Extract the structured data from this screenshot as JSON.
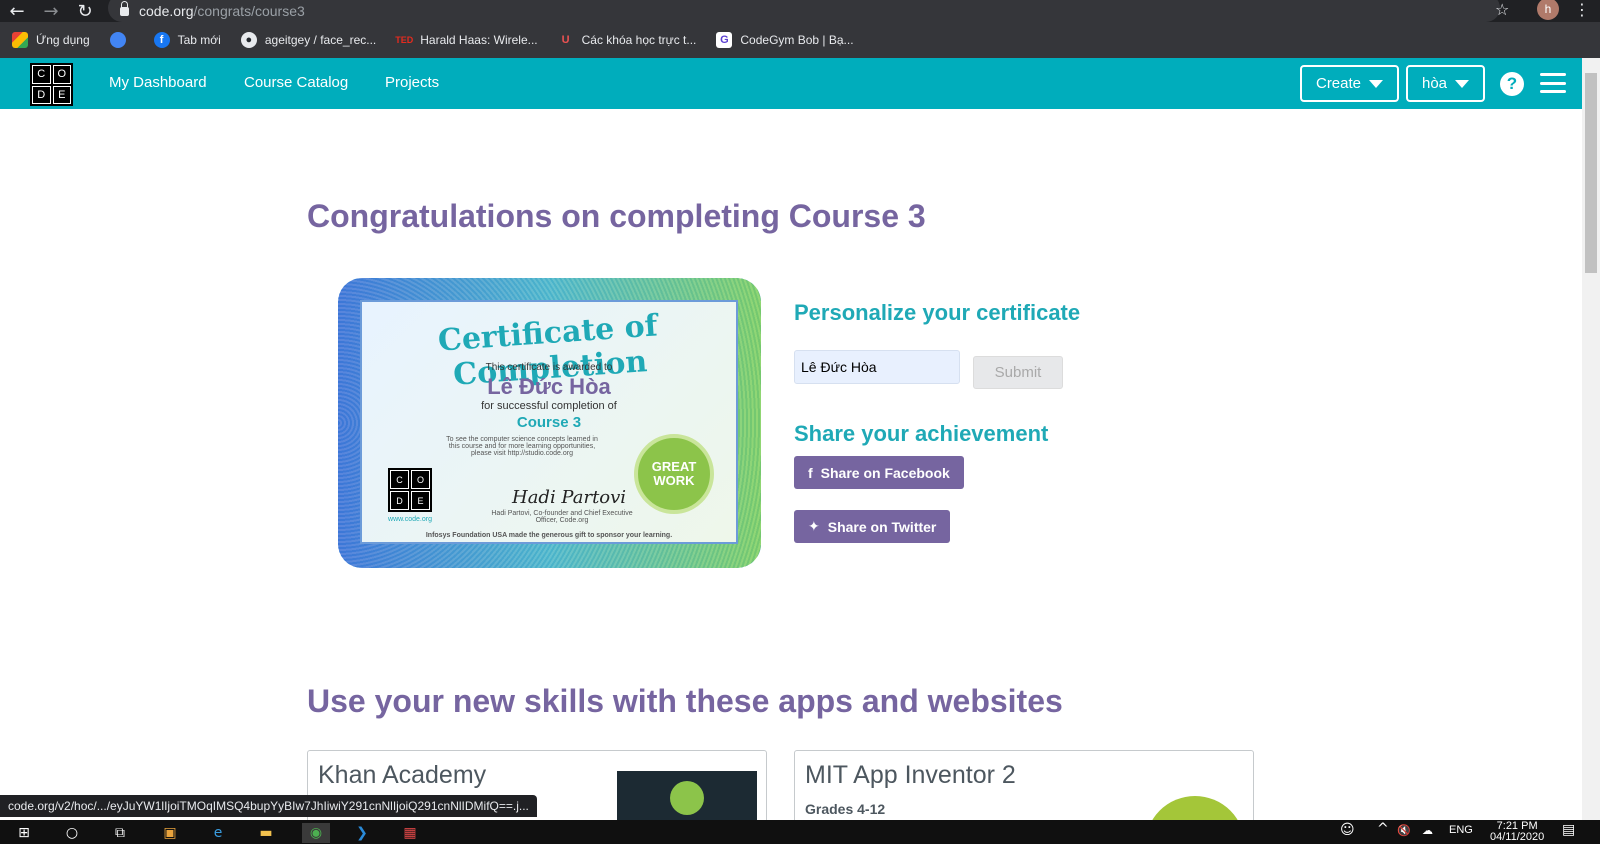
{
  "browser": {
    "url_host": "code.org",
    "url_path": "/congrats/course3",
    "profile_initial": "h",
    "bookmarks": [
      {
        "label": "Ứng dụng",
        "icon": "apps-grid-icon",
        "color": "#e94235"
      },
      {
        "label": "",
        "icon": "chrome-web-store-icon",
        "color": "#4285f4"
      },
      {
        "label": "Tab mới",
        "icon": "facebook-icon",
        "color": "#1877f2"
      },
      {
        "label": "ageitgey / face_rec...",
        "icon": "github-icon",
        "color": "#24292e"
      },
      {
        "label": "Harald Haas: Wirele...",
        "icon": "ted-icon",
        "color": "#e62b1e"
      },
      {
        "label": "Các khóa học trực t...",
        "icon": "udemy-icon",
        "color": "#ec5252"
      },
      {
        "label": "CodeGym Bob | Bạ...",
        "icon": "codegym-icon",
        "color": "#5b3fd1"
      }
    ]
  },
  "header": {
    "logo_letters": [
      "C",
      "O",
      "D",
      "E"
    ],
    "nav": [
      "My Dashboard",
      "Course Catalog",
      "Projects"
    ],
    "create_label": "Create",
    "user_label": "hòa",
    "help_label": "?"
  },
  "main": {
    "title": "Congratulations on completing Course 3",
    "certificate": {
      "heading": "Certificate of Completion",
      "awarded": "This certificate is awarded to",
      "name": "Lê Đức Hòa",
      "completion": "for successful completion of",
      "course": "Course 3",
      "info": "To see the computer science concepts learned in this course and for more learning opportunities, please visit http://studio.code.org",
      "signature": "Hadi Partovi",
      "signer": "Hadi Partovi, Co-founder and Chief Executive Officer, Code.org",
      "website": "www.code.org",
      "sponsor": "Infosys Foundation USA made the generous gift to sponsor your learning.",
      "badge": "GREAT WORK"
    },
    "personalize_heading": "Personalize your certificate",
    "name_value": "Lê Đức Hòa",
    "submit_label": "Submit",
    "share_heading": "Share your achievement",
    "share_facebook": "Share on Facebook",
    "share_twitter": "Share on Twitter",
    "apps_heading": "Use your new skills with these apps and websites",
    "cards": [
      {
        "title": "Khan Academy",
        "subtitle": ""
      },
      {
        "title": "MIT App Inventor 2",
        "subtitle": "Grades 4-12"
      }
    ]
  },
  "status_url": "code.org/v2/hoc/.../eyJuYW1lIjoiTMOqIMSQ4bupYyBIw7JhIiwiY291cnNlIjoiQ291cnNlIDMifQ==.j...",
  "taskbar": {
    "lang": "ENG",
    "time": "7:21 PM",
    "date": "04/11/2020"
  },
  "colors": {
    "teal": "#00adbc",
    "purple": "#7665a0",
    "teal_text": "#1fa9b6"
  }
}
